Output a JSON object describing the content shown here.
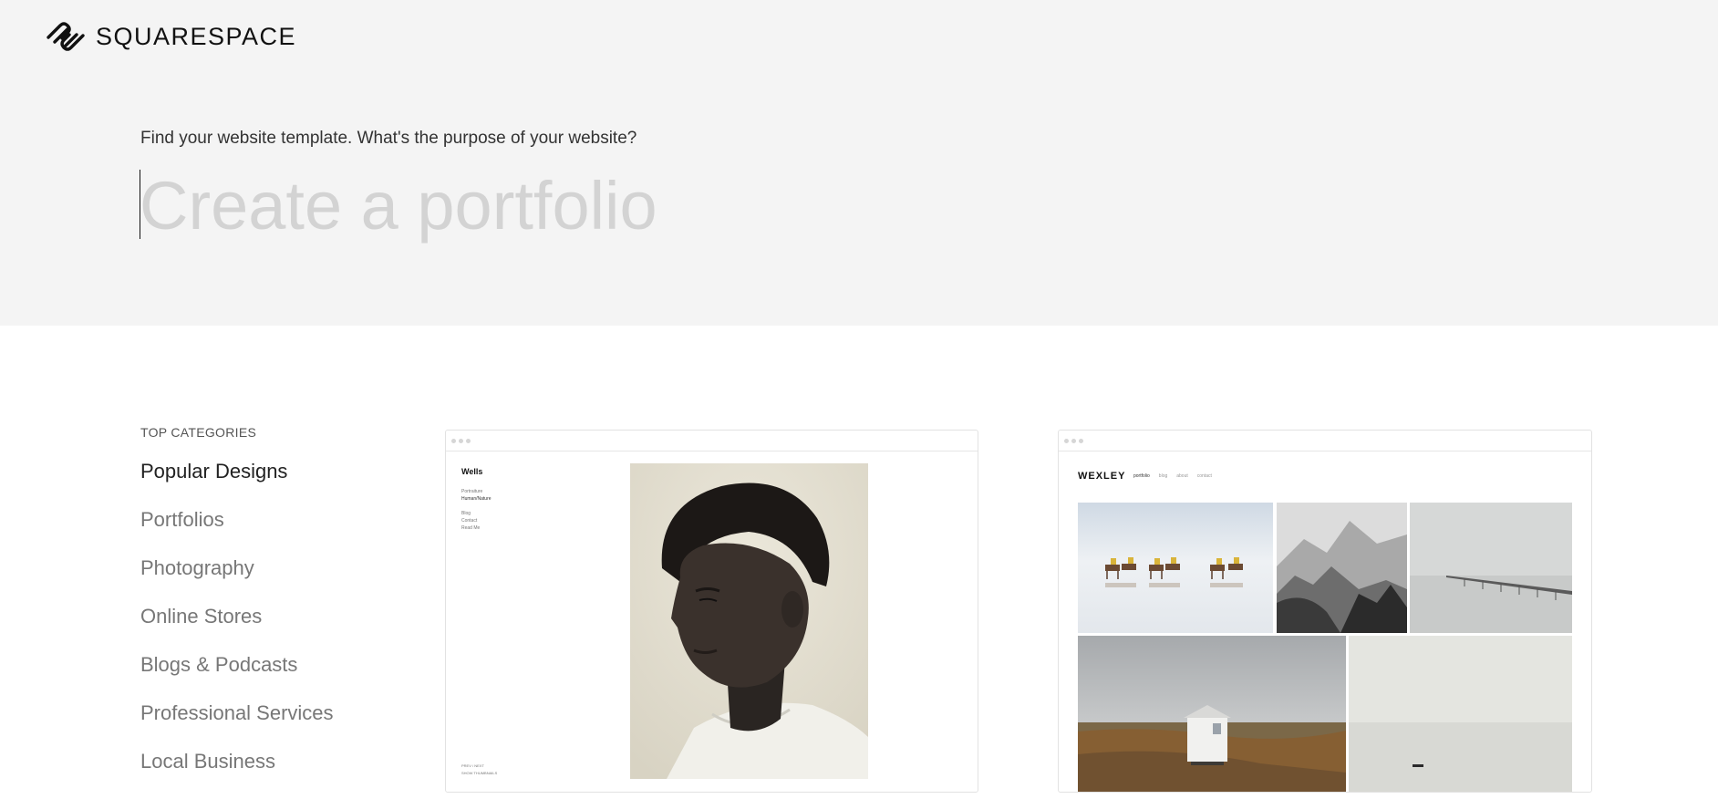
{
  "header": {
    "brand": "SQUARESPACE"
  },
  "hero": {
    "prompt": "Find your website template. What's the purpose of your website?",
    "search_placeholder": "Create a portfolio"
  },
  "categories": {
    "heading": "TOP CATEGORIES",
    "items": [
      {
        "label": "Popular Designs",
        "active": true
      },
      {
        "label": "Portfolios"
      },
      {
        "label": "Photography"
      },
      {
        "label": "Online Stores"
      },
      {
        "label": "Blogs & Podcasts"
      },
      {
        "label": "Professional Services"
      },
      {
        "label": "Local Business"
      }
    ]
  },
  "templates": [
    {
      "title": "Wells",
      "nav": [
        "Portraiture",
        "Human/Nature",
        "Blog",
        "Contact",
        "Read Me"
      ],
      "footer": [
        "PREV / NEXT",
        "SHOW THUMBNAILS"
      ]
    },
    {
      "logo": "WEXLEY",
      "nav": [
        "portfolio",
        "blog",
        "about",
        "contact"
      ]
    }
  ],
  "colors": {
    "hero_bg": "#f4f4f4",
    "placeholder": "#d3d3d3"
  }
}
